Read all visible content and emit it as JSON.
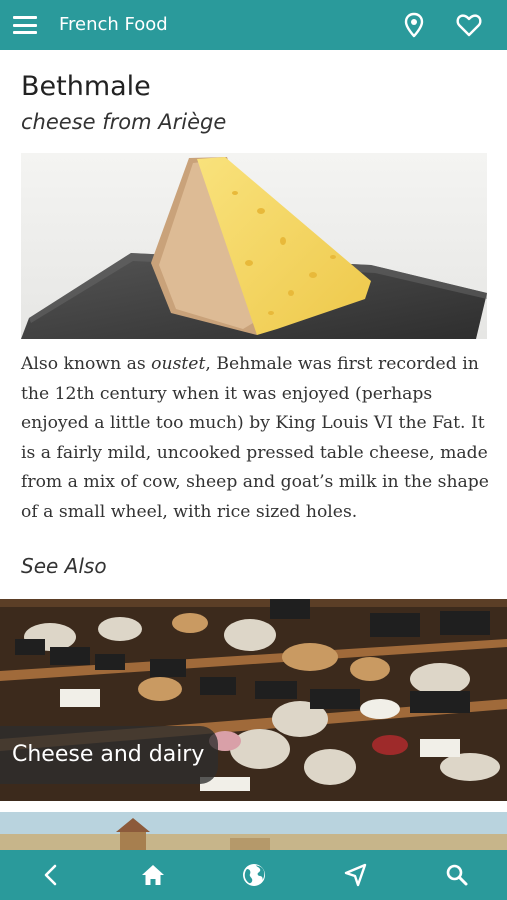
{
  "app": {
    "title": "French Food"
  },
  "colors": {
    "accent": "#2a9a9b"
  },
  "toolbar": {
    "icons": [
      "menu-icon",
      "location-pin-icon",
      "heart-icon"
    ]
  },
  "article": {
    "title": "Bethmale",
    "subtitle": "cheese from Ariège",
    "body_prefix": "Also known as ",
    "body_italic": "oustet",
    "body_rest": ", Behmale was first recorded in the 12th century when it was enjoyed (perhaps enjoyed a little too much) by King Louis VI the Fat. It is a fairly mild, uncooked pressed table cheese, made from a mix of cow, sheep and goat’s milk in the shape of a small wheel, with rice sized holes."
  },
  "see_also": {
    "heading": "See Also",
    "items": [
      {
        "label": "Cheese and dairy"
      }
    ]
  },
  "bottom_nav": {
    "icons": [
      "back-icon",
      "home-icon",
      "globe-icon",
      "navigate-icon",
      "search-icon"
    ]
  }
}
